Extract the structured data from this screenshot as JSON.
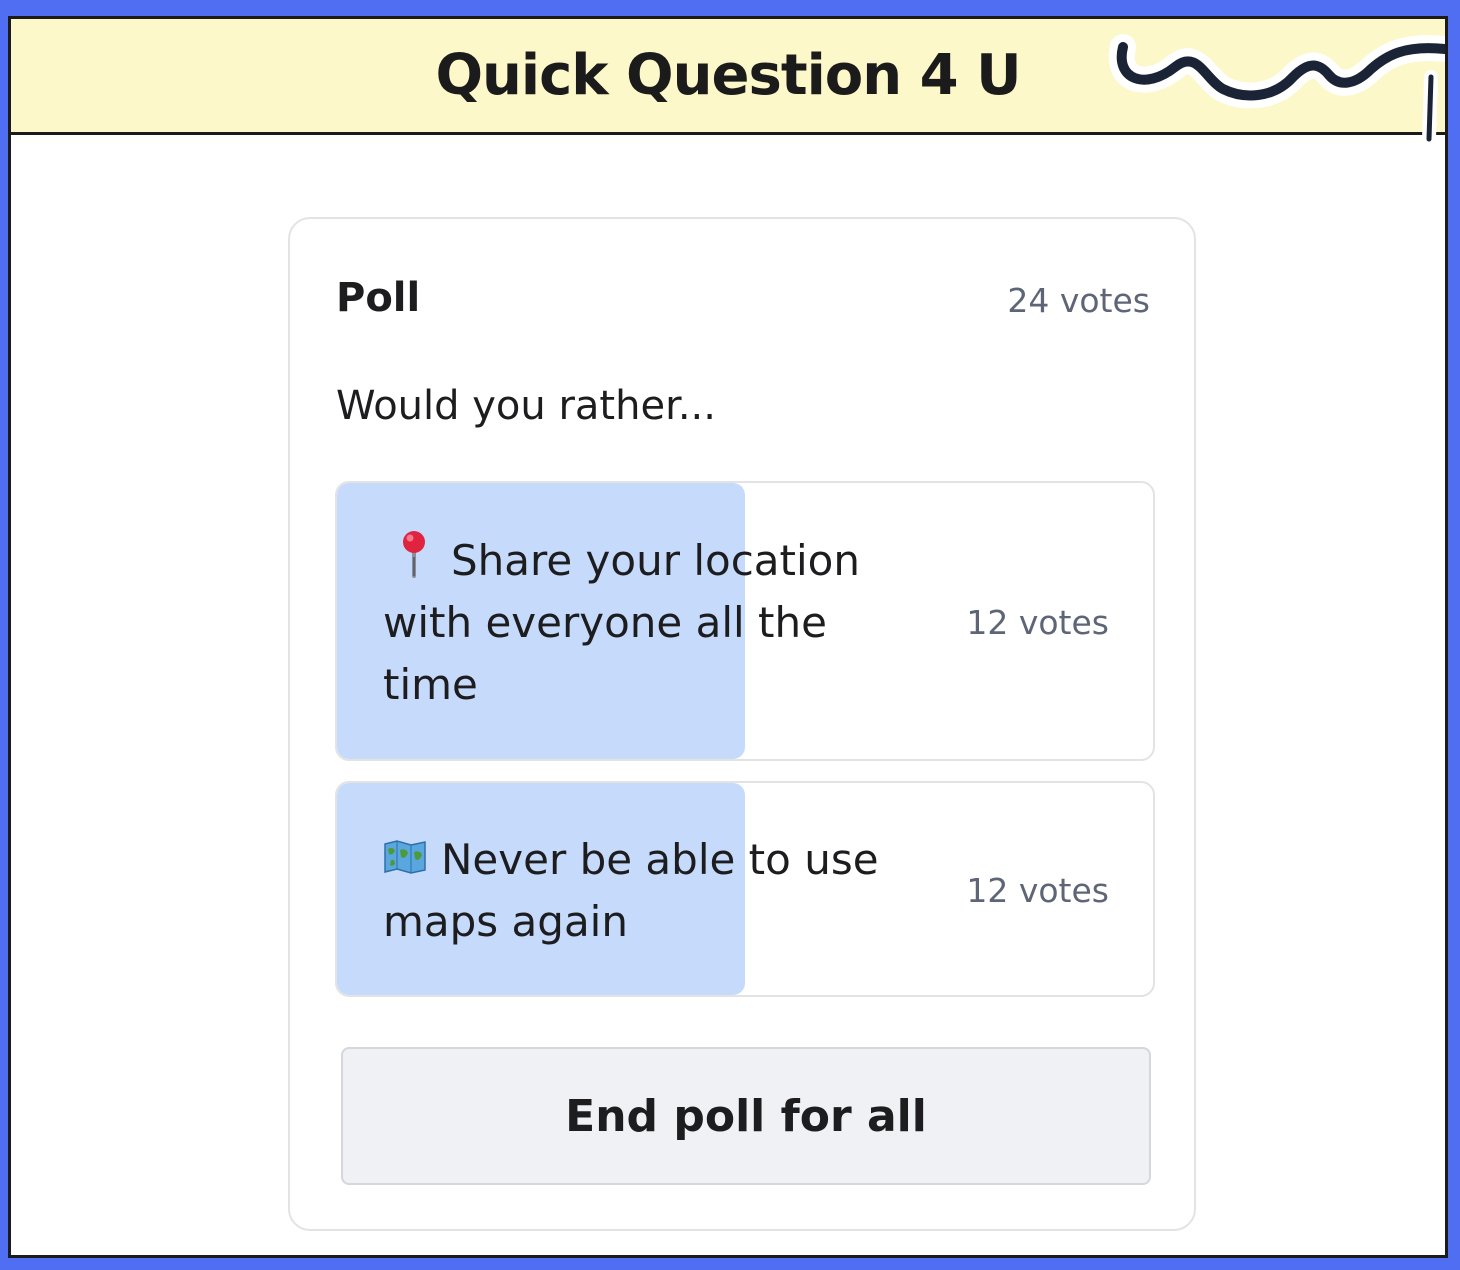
{
  "window": {
    "title": "Quick Question 4 U"
  },
  "poll": {
    "label": "Poll",
    "total_votes": "24 votes",
    "question": "Would you rather...",
    "options": [
      {
        "icon": "round-pushpin-icon",
        "label": "Share your location with everyone all the time",
        "votes": "12 votes",
        "fraction": 0.5
      },
      {
        "icon": "world-map-icon",
        "label": "Never be able to use maps again",
        "votes": "12 votes",
        "fraction": 0.5
      }
    ],
    "end_button_label": "End poll for all"
  },
  "colors": {
    "background": "#4f6ef2",
    "title_bar": "#fcf8c9",
    "result_fill": "#c6dafb",
    "button_bg": "#f0f1f5",
    "muted_text": "#5d6577"
  }
}
